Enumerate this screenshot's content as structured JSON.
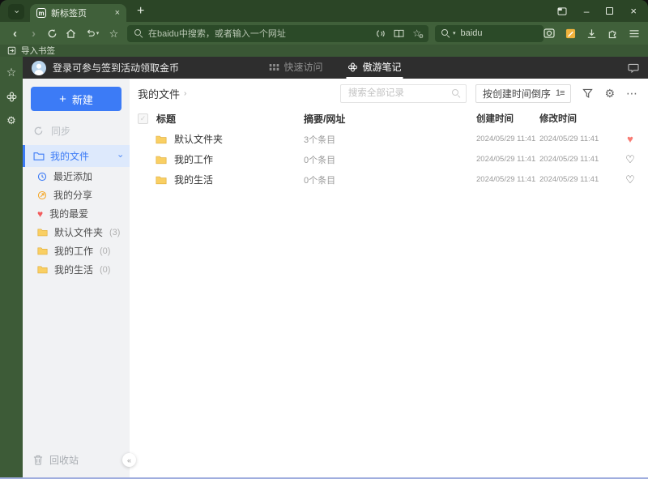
{
  "icons": {
    "tab_menu_chevron": "›",
    "back": "‹",
    "forward": "›",
    "plus": "+",
    "close": "×",
    "minimize": "–",
    "star": "☆",
    "gear": "⚙",
    "more": "⋯",
    "collapse": "«",
    "heart_filled": "♥",
    "heart_outline": "♡",
    "check": "✓",
    "caret_down": "▾",
    "breadcrumb_caret": "›",
    "chevron_down": "›",
    "sort_glyph": "1≡",
    "logo_letter": "m"
  },
  "browser": {
    "tab_title": "新标签页",
    "address_placeholder": "在baidu中搜索，或者输入一个网址",
    "search_value": "baidu",
    "bookmarks": {
      "import_label": "导入书签"
    }
  },
  "notes": {
    "header": {
      "login_text": "登录可参与签到活动领取金币",
      "tab_quick_access": "快速访问",
      "tab_notes": "傲游笔记"
    },
    "sidebar": {
      "new_label": "新建",
      "sync_label": "同步",
      "my_files_label": "我的文件",
      "items": [
        {
          "label": "最近添加"
        },
        {
          "label": "我的分享"
        },
        {
          "label": "我的最爱"
        },
        {
          "label": "默认文件夹",
          "count": "(3)"
        },
        {
          "label": "我的工作",
          "count": "(0)"
        },
        {
          "label": "我的生活",
          "count": "(0)"
        }
      ],
      "recycle_label": "回收站"
    },
    "content": {
      "breadcrumb": "我的文件",
      "search_placeholder": "搜索全部记录",
      "sort_label": "按创建时间倒序",
      "columns": [
        "标题",
        "摘要/网址",
        "创建时间",
        "修改时间"
      ],
      "rows": [
        {
          "title": "默认文件夹",
          "summary": "3个条目",
          "created": "2024/05/29 11:41",
          "modified": "2024/05/29 11:41",
          "favorite": true
        },
        {
          "title": "我的工作",
          "summary": "0个条目",
          "created": "2024/05/29 11:41",
          "modified": "2024/05/29 11:41",
          "favorite": false
        },
        {
          "title": "我的生活",
          "summary": "0个条目",
          "created": "2024/05/29 11:41",
          "modified": "2024/05/29 11:41",
          "favorite": false
        }
      ]
    }
  },
  "colors": {
    "titlebar": "#2b4526",
    "toolbar": "#40603a",
    "field": "#2b4a28",
    "header_dark": "#2e2e2e",
    "accent_blue": "#3c7bf6",
    "folder_yellow": "#f9cf63",
    "heart_red": "#f87b73"
  }
}
